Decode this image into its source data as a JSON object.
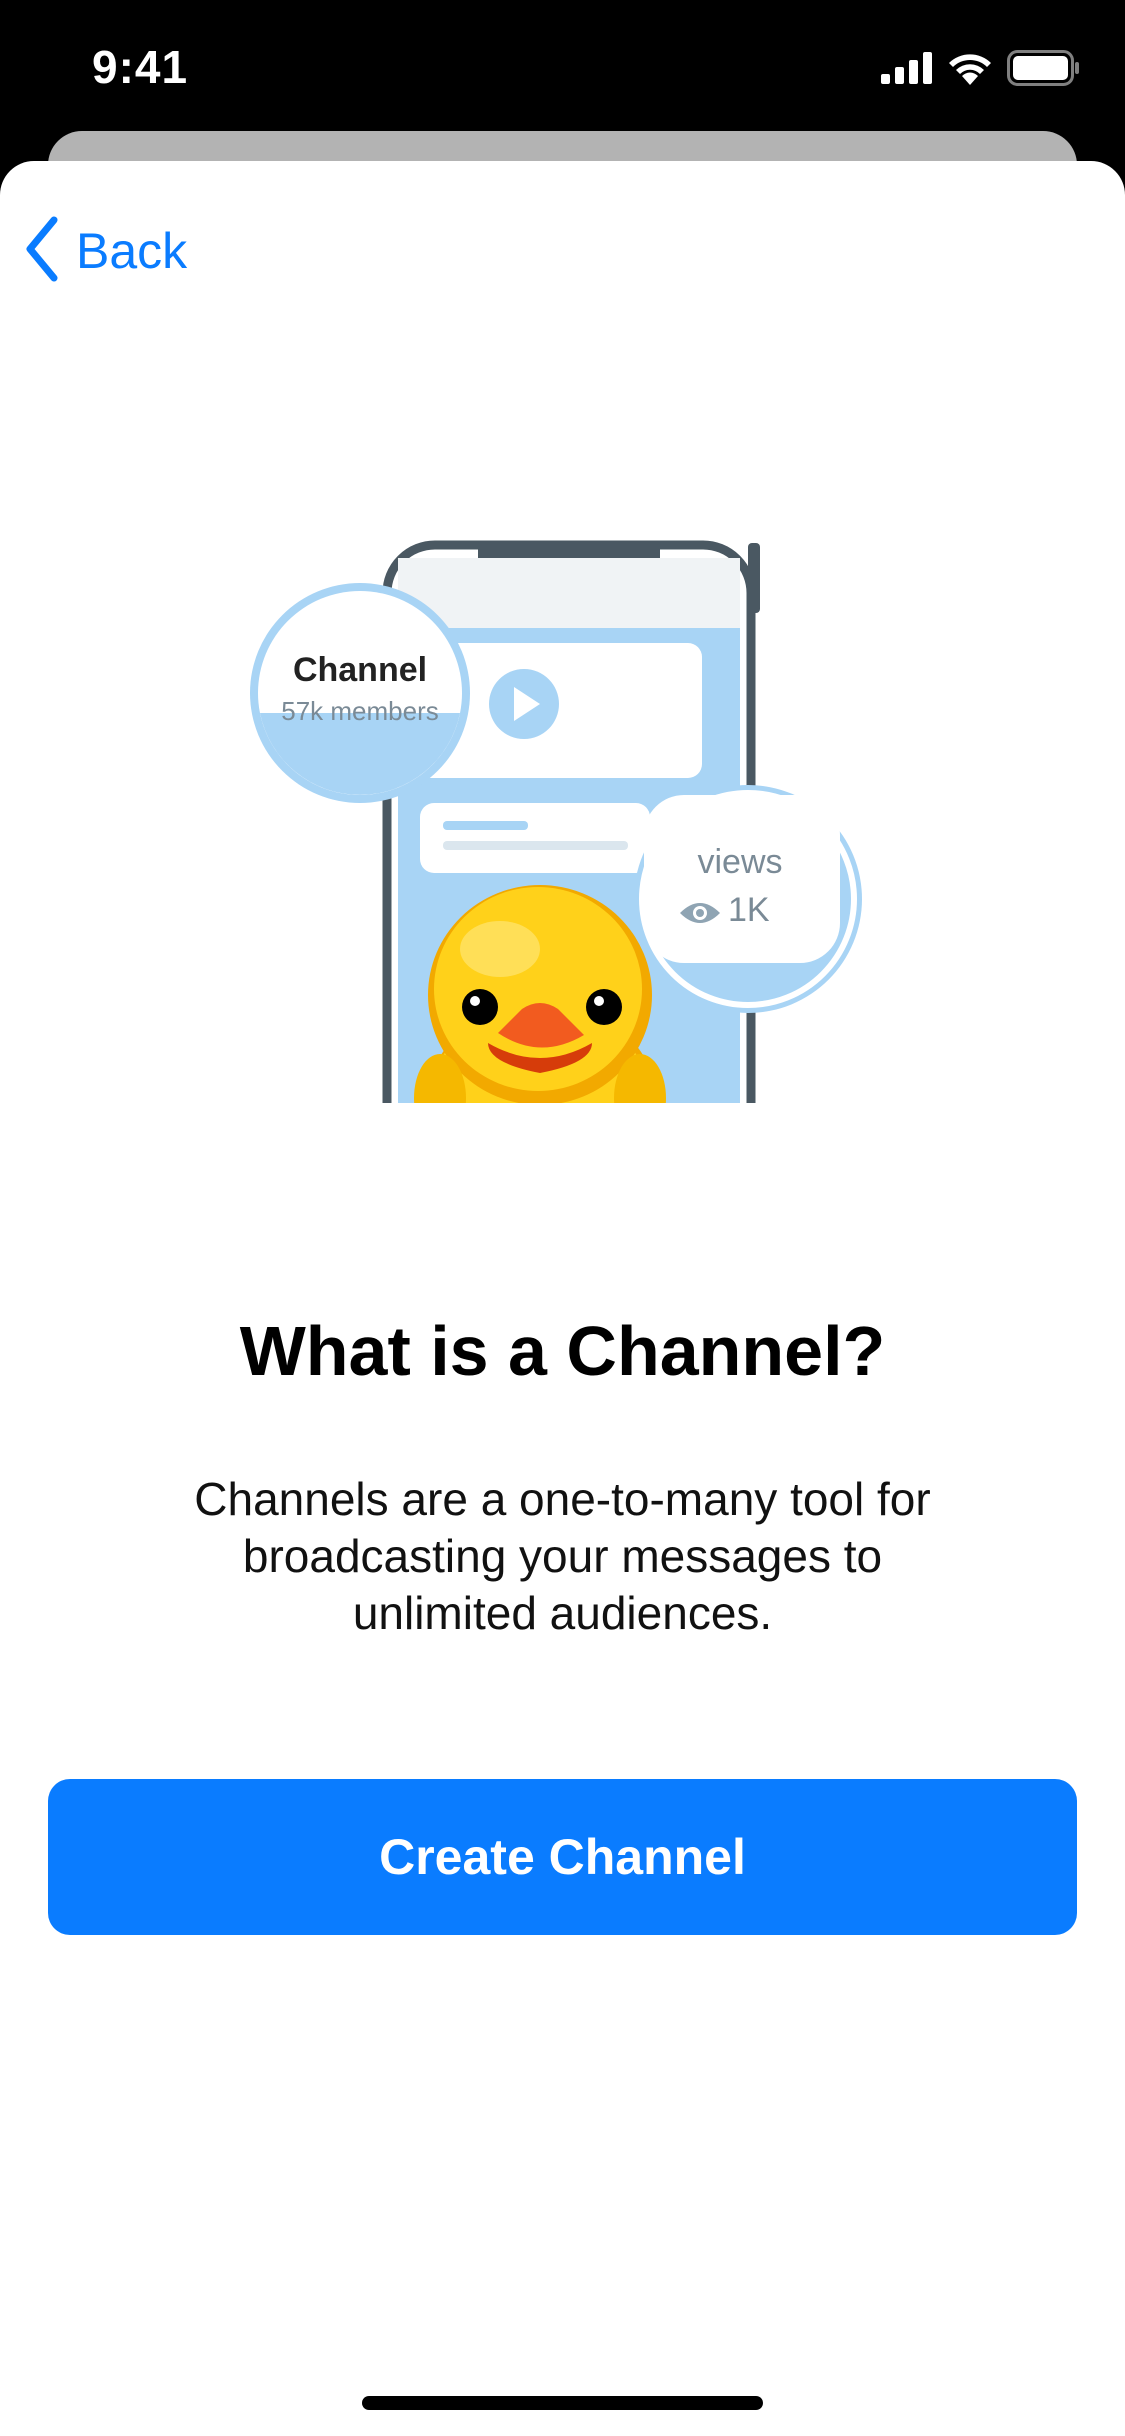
{
  "status_bar": {
    "time": "9:41",
    "icons": [
      "cellular-signal-icon",
      "wifi-icon",
      "battery-icon"
    ]
  },
  "nav": {
    "back_label": "Back",
    "back_icon": "chevron-left-icon"
  },
  "illustration": {
    "channel_name": "Channel",
    "channel_members": "57k members",
    "views_label": "views",
    "views_count": "1K",
    "icons": [
      "play-icon",
      "eye-icon",
      "duck-sticker"
    ]
  },
  "main": {
    "title": "What is a Channel?",
    "description": "Channels are a one-to-many tool for broadcasting your messages to unlimited audiences.",
    "create_button_label": "Create Channel"
  },
  "colors": {
    "accent": "#0a7cff",
    "illustration_light_blue": "#a8d4f5",
    "phone_frame": "#4a5862",
    "duck_yellow": "#ffd11a",
    "duck_beak": "#f25b1f"
  }
}
